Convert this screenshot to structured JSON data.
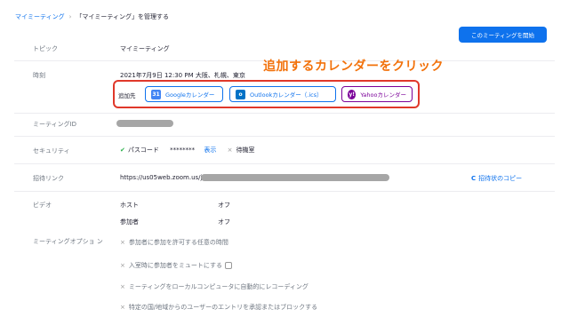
{
  "breadcrumb": {
    "parent": "マイミーティング",
    "separator": "›",
    "current": "「マイミーティング」を管理する"
  },
  "header": {
    "start_button": "このミーティングを開始"
  },
  "annotation": "追加するカレンダーをクリック",
  "topic": {
    "label": "トピック",
    "value": "マイミーティング"
  },
  "time": {
    "label": "時刻",
    "value": "2021年7月9日 12:30 PM 大阪、札幌、東京",
    "add_to_label": "追加先"
  },
  "calendars": {
    "google": {
      "label": "Googleカレンダー",
      "icon": "31"
    },
    "outlook": {
      "label": "Outlookカレンダー（.ics）",
      "icon": "o"
    },
    "yahoo": {
      "label": "Yahooカレンダー",
      "icon": "y!"
    }
  },
  "meeting_id": {
    "label": "ミーティングID"
  },
  "security": {
    "label": "セキュリティ",
    "check": "✔",
    "passcode_label": "パスコード",
    "passcode_mask": "********",
    "show_link": "表示",
    "x": "×",
    "waiting_room": "待機室"
  },
  "invite": {
    "label": "招待リンク",
    "url": "https://us05web.zoom.us/j/",
    "copy_icon": "C",
    "copy_label": "招待状のコピー"
  },
  "video": {
    "label": "ビデオ",
    "host_label": "ホスト",
    "host_value": "オフ",
    "participant_label": "参加者",
    "participant_value": "オフ"
  },
  "options": {
    "label": "ミーティングオプショ ン",
    "items": [
      "参加者に参加を許可する任意の時間",
      "入室時に参加者をミュートにする",
      "ミーティングをローカルコンピュータに自動的にレコーディング",
      "特定の国/地域からのユーザーのエントリを承認またはブロックする"
    ],
    "x": "×"
  },
  "colors": {
    "accent": "#0e72ed",
    "annotation": "#f2710a",
    "highlight_box": "#e0382a",
    "yahoo": "#7b0099",
    "google": "#4285f4",
    "outlook": "#0072c6"
  }
}
